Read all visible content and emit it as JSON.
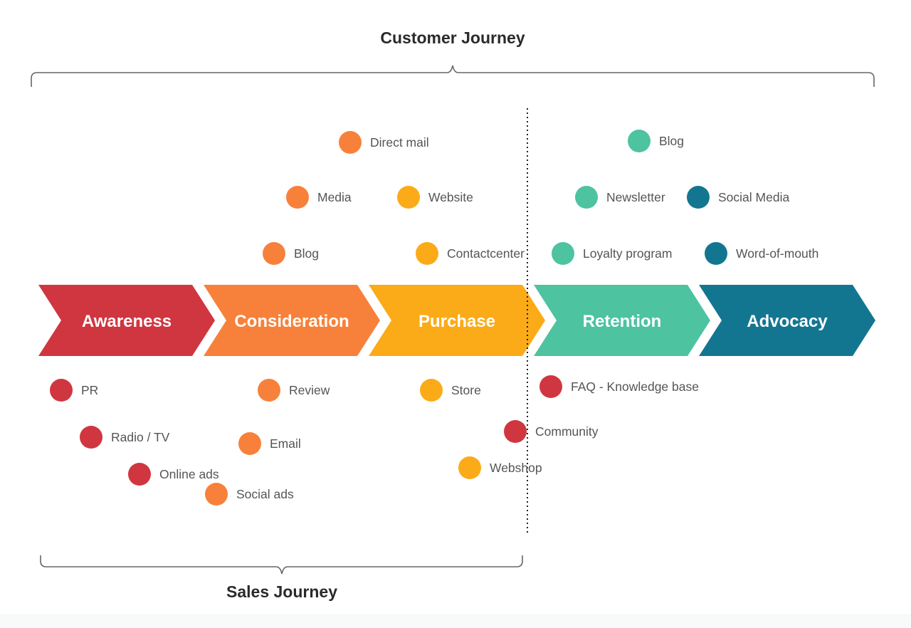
{
  "title_top": "Customer Journey",
  "title_bottom": "Sales Journey",
  "colors": {
    "awareness": "#d0363f",
    "consideration": "#f7813a",
    "purchase": "#fbab18",
    "retention": "#4dc3a0",
    "advocacy": "#137691",
    "text": "#555555",
    "heading": "#2a2a2a",
    "bracket": "#666666",
    "divider": "#222222"
  },
  "stages": [
    {
      "id": "awareness",
      "label": "Awareness"
    },
    {
      "id": "consideration",
      "label": "Consideration"
    },
    {
      "id": "purchase",
      "label": "Purchase"
    },
    {
      "id": "retention",
      "label": "Retention"
    },
    {
      "id": "advocacy",
      "label": "Advocacy"
    }
  ],
  "channels": [
    {
      "label": "Direct mail",
      "stage": "consideration"
    },
    {
      "label": "Media",
      "stage": "consideration"
    },
    {
      "label": "Website",
      "stage": "purchase"
    },
    {
      "label": "Blog",
      "stage": "consideration"
    },
    {
      "label": "Contactcenter",
      "stage": "purchase"
    },
    {
      "label": "Blog",
      "stage": "retention"
    },
    {
      "label": "Newsletter",
      "stage": "retention"
    },
    {
      "label": "Social Media",
      "stage": "advocacy"
    },
    {
      "label": "Loyalty program",
      "stage": "retention"
    },
    {
      "label": "Word-of-mouth",
      "stage": "advocacy"
    },
    {
      "label": "PR",
      "stage": "awareness"
    },
    {
      "label": "Radio / TV",
      "stage": "awareness"
    },
    {
      "label": "Online ads",
      "stage": "awareness"
    },
    {
      "label": "Review",
      "stage": "consideration"
    },
    {
      "label": "Email",
      "stage": "consideration"
    },
    {
      "label": "Social ads",
      "stage": "consideration"
    },
    {
      "label": "Store",
      "stage": "purchase"
    },
    {
      "label": "Webshop",
      "stage": "purchase"
    },
    {
      "label": "FAQ - Knowledge base",
      "stage": "awareness"
    },
    {
      "label": "Community",
      "stage": "awareness"
    }
  ]
}
